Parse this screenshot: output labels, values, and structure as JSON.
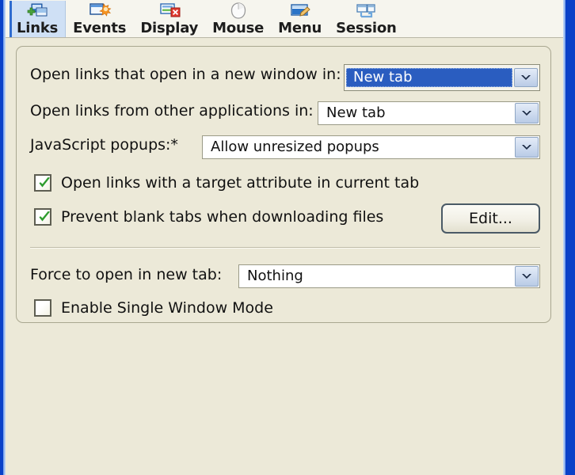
{
  "window": {
    "chrome_color": "#0a41c8",
    "background": "#ece9d8"
  },
  "tabs": {
    "items": [
      {
        "label": "Links",
        "icon": "links-icon",
        "selected": true
      },
      {
        "label": "Events",
        "icon": "events-icon",
        "selected": false
      },
      {
        "label": "Display",
        "icon": "display-icon",
        "selected": false
      },
      {
        "label": "Mouse",
        "icon": "mouse-icon",
        "selected": false
      },
      {
        "label": "Menu",
        "icon": "menu-icon",
        "selected": false
      },
      {
        "label": "Session",
        "icon": "session-icon",
        "selected": false
      }
    ],
    "selected_color": "#cfe0f5",
    "selected_marker_color": "#2f6ccf"
  },
  "panel": {
    "rows": {
      "open_new_window": {
        "label": "Open links that open in a new window in:",
        "value": "New tab",
        "focused": true,
        "highlight_color": "#2a5dc0"
      },
      "open_other_apps": {
        "label": "Open links from other applications in:",
        "value": "New tab",
        "focused": false
      },
      "javascript_popups": {
        "label": "JavaScript popups:*",
        "value": "Allow unresized popups",
        "focused": false
      },
      "target_attribute": {
        "label": "Open links with a target attribute in current tab",
        "checked": true
      },
      "blank_tabs": {
        "label": "Prevent blank tabs when downloading files",
        "checked": true
      },
      "edit_button": {
        "label": "Edit..."
      },
      "force_new_tab": {
        "label": "Force to open in new tab:",
        "value": "Nothing",
        "focused": false
      },
      "single_window_mode": {
        "label": "Enable Single Window Mode",
        "checked": false
      }
    }
  }
}
